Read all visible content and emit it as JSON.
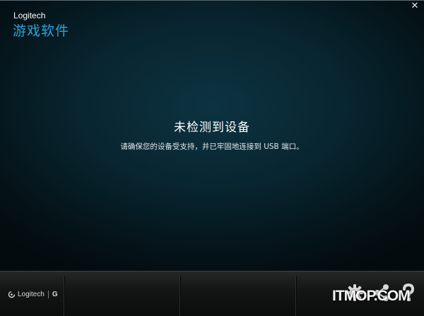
{
  "window": {
    "brand": "Logitech",
    "app_title": "游戏软件",
    "close_glyph": "✕"
  },
  "message": {
    "title": "未检测到设备",
    "body": "请确保您的设备受支持，并已牢固地连接到 USB 端口。"
  },
  "bottom_bar": {
    "logo_text": "Logitech",
    "logo_mark": "G",
    "icons": [
      "gear-icon",
      "share-icon",
      "help-icon"
    ]
  },
  "watermark": "ITMOP.COM",
  "colors": {
    "accent": "#2aa6d9",
    "background": "#082530"
  }
}
